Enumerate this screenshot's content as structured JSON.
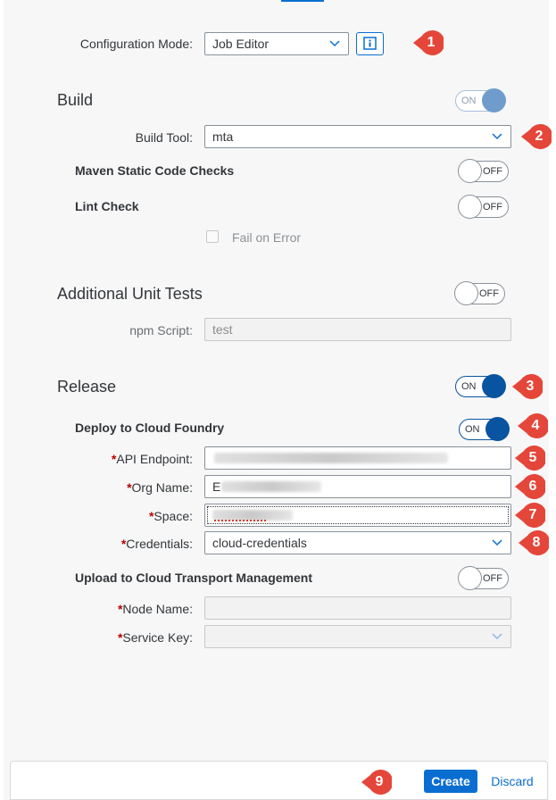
{
  "config": {
    "label": "Configuration Mode:",
    "value": "Job Editor"
  },
  "build": {
    "title": "Build",
    "toggle": "ON",
    "tool_label": "Build Tool:",
    "tool_value": "mta",
    "maven_label": "Maven Static Code Checks",
    "maven_toggle": "OFF",
    "lint_label": "Lint Check",
    "lint_toggle": "OFF",
    "fail_label": "Fail on Error"
  },
  "unit_tests": {
    "title": "Additional Unit Tests",
    "toggle": "OFF",
    "npm_label": "npm Script:",
    "npm_placeholder": "test"
  },
  "release": {
    "title": "Release",
    "toggle": "ON",
    "cf_label": "Deploy to Cloud Foundry",
    "cf_toggle": "ON",
    "api_label": "API Endpoint:",
    "org_label": "Org Name:",
    "org_value_prefix": "E",
    "space_label": "Space:",
    "cred_label": "Credentials:",
    "cred_value": "cloud-credentials",
    "ctm_label": "Upload to Cloud Transport Management",
    "ctm_toggle": "OFF",
    "node_label": "Node Name:",
    "service_key_label": "Service Key:"
  },
  "required_mark": "*",
  "footer": {
    "create": "Create",
    "discard": "Discard"
  },
  "callouts": [
    "1",
    "2",
    "3",
    "4",
    "5",
    "6",
    "7",
    "8",
    "9"
  ],
  "colors": {
    "accent": "#0a6ed1",
    "callout": "#e5463a",
    "required": "#bb0000"
  },
  "icons": {
    "info": "info-icon",
    "chevron": "chevron-down-icon"
  }
}
